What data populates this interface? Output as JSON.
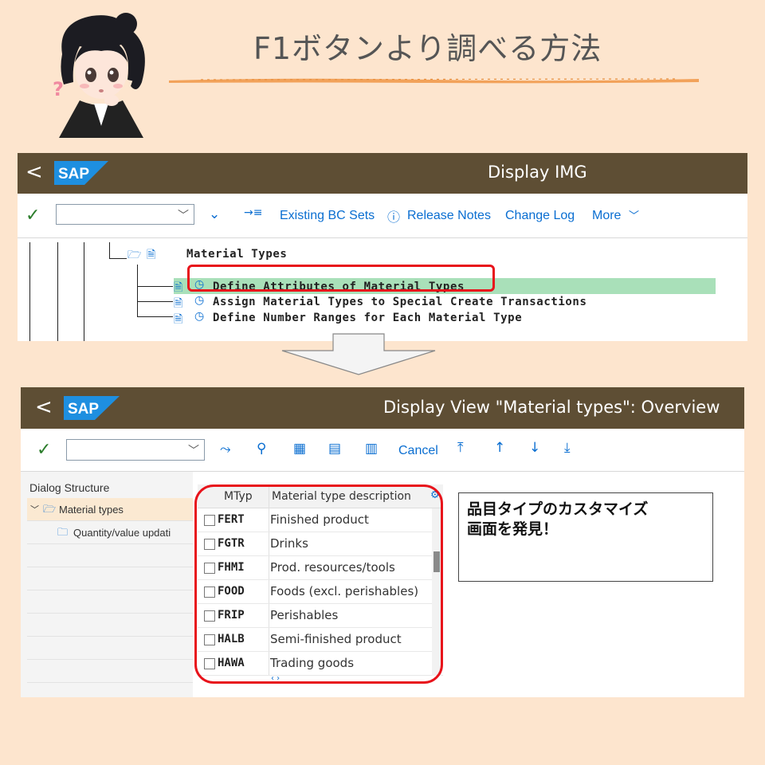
{
  "header": {
    "title": "F1ボタンより調べる方法",
    "question_mark": "?"
  },
  "shell1": {
    "back": "<",
    "logo": "SAP",
    "title": "Display IMG",
    "toolbar": {
      "existing_bc_sets": "Existing BC Sets",
      "release_notes": "Release Notes",
      "change_log": "Change Log",
      "more": "More"
    },
    "tree": {
      "parent": "Material Types",
      "items": [
        "Define Attributes of Material Types",
        "Assign Material Types to Special  Create  Transactions",
        "Define Number Ranges for Each Material Type"
      ]
    }
  },
  "shell2": {
    "back": "<",
    "logo": "SAP",
    "title": "Display View \"Material types\": Overview",
    "toolbar": {
      "cancel": "Cancel"
    },
    "dialog_structure": {
      "title": "Dialog Structure",
      "items": [
        "Material types",
        "Quantity/value updati"
      ]
    },
    "table": {
      "headers": [
        "MTyp",
        "Material type description"
      ],
      "rows": [
        {
          "code": "FERT",
          "desc": "Finished product"
        },
        {
          "code": "FGTR",
          "desc": "Drinks"
        },
        {
          "code": "FHMI",
          "desc": "Prod. resources/tools"
        },
        {
          "code": "FOOD",
          "desc": "Foods (excl. perishables)"
        },
        {
          "code": "FRIP",
          "desc": "Perishables"
        },
        {
          "code": "HALB",
          "desc": "Semi-finished product"
        },
        {
          "code": "HAWA",
          "desc": "Trading goods"
        }
      ]
    },
    "note": {
      "line1": "品目タイプのカスタマイズ",
      "line2": "画面を発見！"
    }
  },
  "colors": {
    "background": "#fde5ce",
    "shellbar": "#5e4e34",
    "link_blue": "#0a6ed1",
    "highlight": "#e8131b",
    "selected_row": "#a9e0b9"
  }
}
